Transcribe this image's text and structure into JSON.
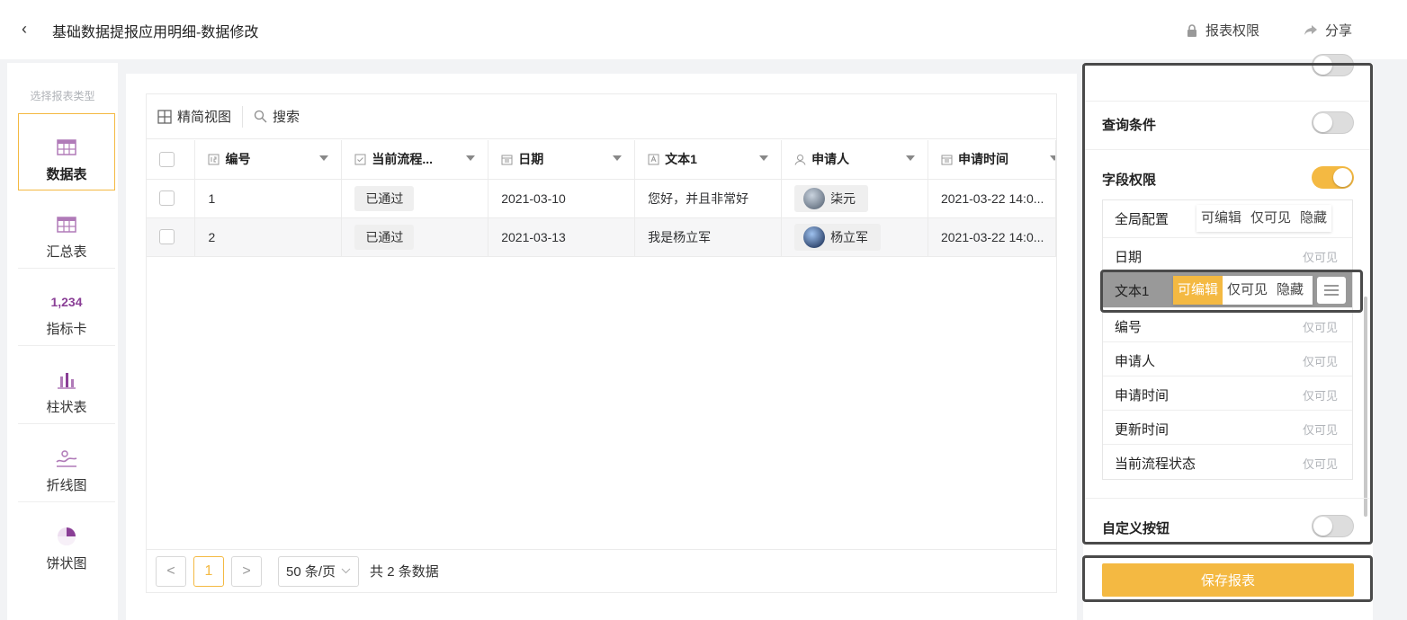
{
  "header": {
    "title": "基础数据提报应用明细-数据修改",
    "perm_label": "报表权限",
    "share_label": "分享",
    "back_icon": "chevron-left-icon"
  },
  "sidebar": {
    "heading": "选择报表类型",
    "items": [
      {
        "label": "数据表",
        "icon": "data-table-icon",
        "active": true
      },
      {
        "label": "汇总表",
        "icon": "summary-table-icon",
        "active": false
      },
      {
        "label": "指标卡",
        "icon": "kpi-card-icon",
        "icon_text": "1,234",
        "active": false
      },
      {
        "label": "柱状表",
        "icon": "bar-chart-icon",
        "active": false
      },
      {
        "label": "折线图",
        "icon": "line-chart-icon",
        "active": false
      },
      {
        "label": "饼状图",
        "icon": "pie-chart-icon",
        "active": false
      }
    ]
  },
  "toolbar": {
    "view_label": "精简视图",
    "search_label": "搜索"
  },
  "table": {
    "columns": [
      "编号",
      "当前流程...",
      "日期",
      "文本1",
      "申请人",
      "申请时间"
    ],
    "rows": [
      {
        "num": "1",
        "status": "已通过",
        "date": "2021-03-10",
        "text": "您好，并且非常好",
        "applicant": "柒元",
        "time": "2021-03-22 14:0..."
      },
      {
        "num": "2",
        "status": "已通过",
        "date": "2021-03-13",
        "text": "我是杨立军",
        "applicant": "杨立军",
        "time": "2021-03-22 14:0..."
      }
    ]
  },
  "pager": {
    "current": "1",
    "page_size": "50 条/页",
    "total": "共 2 条数据"
  },
  "panel": {
    "query_label": "查询条件",
    "field_perm_label": "字段权限",
    "custom_btn_label": "自定义按钮",
    "global": {
      "label": "全局配置",
      "opts": [
        "可编辑",
        "仅可见",
        "隐藏"
      ]
    },
    "fields": [
      {
        "name": "日期",
        "value": "仅可见"
      },
      {
        "name": "文本1",
        "opts": [
          "可编辑",
          "仅可见",
          "隐藏"
        ],
        "selected": "可编辑"
      },
      {
        "name": "编号",
        "value": "仅可见"
      },
      {
        "name": "申请人",
        "value": "仅可见"
      },
      {
        "name": "申请时间",
        "value": "仅可见"
      },
      {
        "name": "更新时间",
        "value": "仅可见"
      },
      {
        "name": "当前流程状态",
        "value": "仅可见"
      }
    ],
    "toggles": {
      "query": false,
      "field_perm": true,
      "custom_btn": false
    },
    "save_label": "保存报表"
  },
  "colors": {
    "accent": "#f4b942",
    "highlight": "#4a4a4a"
  }
}
